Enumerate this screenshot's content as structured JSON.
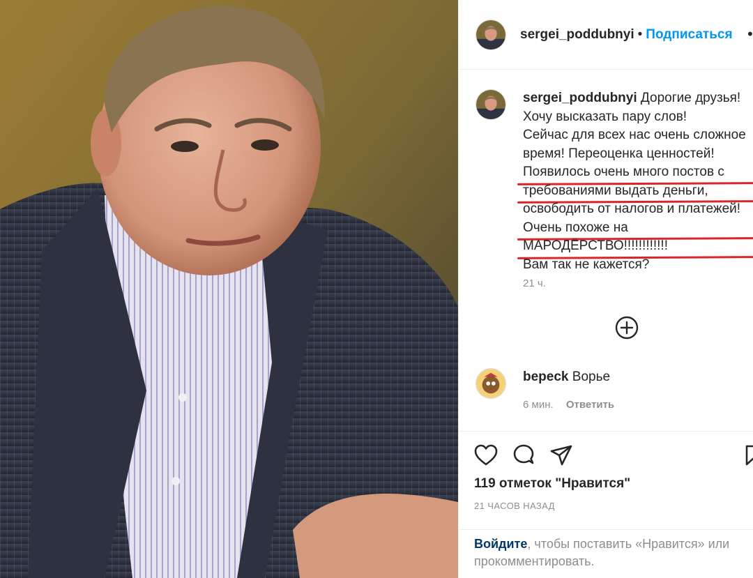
{
  "header": {
    "username": "sergei_poddubnyi",
    "separator": "•",
    "follow_label": "Подписаться",
    "more_label": "•"
  },
  "caption": {
    "username": "sergei_poddubnyi",
    "lines": [
      "Дорогие друзья!",
      "Хочу высказать пару слов!",
      "Сейчас для всех нас очень сложное",
      "время! Переоценка ценностей!",
      "Появилось очень много постов с",
      "требованиями выдать деньги,",
      "освободить от налогов и платежей!",
      "Очень похоже на",
      "МАРОДЁРСТВО!!!!!!!!!!!!",
      "Вам так не кажется?"
    ],
    "time": "21 ч."
  },
  "comment": {
    "username": "bepeck",
    "text": "Ворье",
    "time": "6 мин.",
    "reply_label": "Ответить"
  },
  "actions": {
    "likes": "119 отметок \"Нравится\"",
    "posted": "21 ЧАСОВ НАЗАД"
  },
  "login_prompt": {
    "link": "Войдите",
    "text": ", чтобы поставить «Нравится» или прокомментировать."
  },
  "colors": {
    "accent": "#0095f6",
    "underline": "#d9262b",
    "muted": "#8e8e8e"
  },
  "icons": [
    "heart-icon",
    "comment-icon",
    "share-icon",
    "bookmark-icon",
    "add-comment-icon"
  ]
}
